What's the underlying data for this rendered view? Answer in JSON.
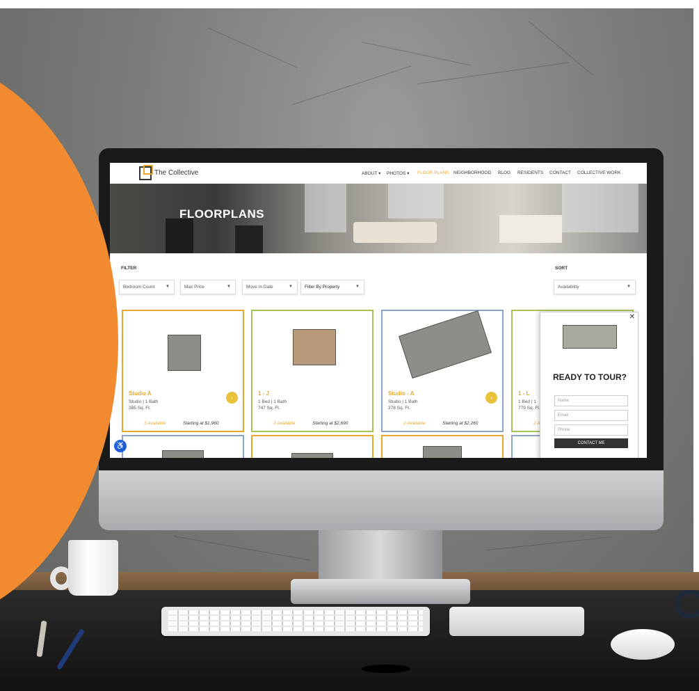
{
  "site": {
    "brand": "The Collective",
    "nav": [
      {
        "label": "ABOUT ▾",
        "active": false
      },
      {
        "label": "PHOTOS ▾",
        "active": false
      },
      {
        "label": "FLOOR PLANS",
        "active": true
      },
      {
        "label": "NEIGHBORHOOD",
        "active": false
      },
      {
        "label": "BLOG",
        "active": false
      },
      {
        "label": "RESIDENTS",
        "active": false
      },
      {
        "label": "CONTACT",
        "active": false
      },
      {
        "label": "COLLECTIVE WORK",
        "active": false
      }
    ]
  },
  "hero": {
    "title": "FLOORPLANS"
  },
  "filter": {
    "label": "FILTER",
    "selects": [
      "Bedroom Count",
      "Max Price",
      "Move In Date",
      "Filter By Property"
    ]
  },
  "sort": {
    "label": "SORT",
    "value": "Availability"
  },
  "cards": [
    {
      "title": "Studio A",
      "beds": "Studio | 1 Bath",
      "sqft": "385 Sq. Ft.",
      "available": "3 Available",
      "price": "Starting at $1,960",
      "border": "#e8a92b"
    },
    {
      "title": "1 - J",
      "beds": "1 Bed | 1 Bath",
      "sqft": "747 Sq. Ft.",
      "available": "3 Available",
      "price": "Starting at $2,690",
      "border": "#a6c35a"
    },
    {
      "title": "Studio - A",
      "beds": "Studio | 1 Bath",
      "sqft": "378 Sq. Ft.",
      "available": "2 Available",
      "price": "Starting at $2,260",
      "border": "#8aa5c9"
    },
    {
      "title": "1 - L",
      "beds": "1 Bed | 1",
      "sqft": "779 Sq. Ft.",
      "available": "2 A",
      "price": "",
      "border": "#a6c35a"
    }
  ],
  "popup": {
    "title": "READY TO TOUR?",
    "name_placeholder": "Name",
    "email_placeholder": "Email",
    "phone_placeholder": "Phone",
    "button": "CONTACT ME",
    "close": "✕"
  },
  "colors": {
    "accent_orange": "#f28a30",
    "brand_gold": "#e8a92b",
    "card_green": "#a6c35a",
    "card_blue": "#8aa5c9",
    "access_blue": "#1f5fe0"
  }
}
